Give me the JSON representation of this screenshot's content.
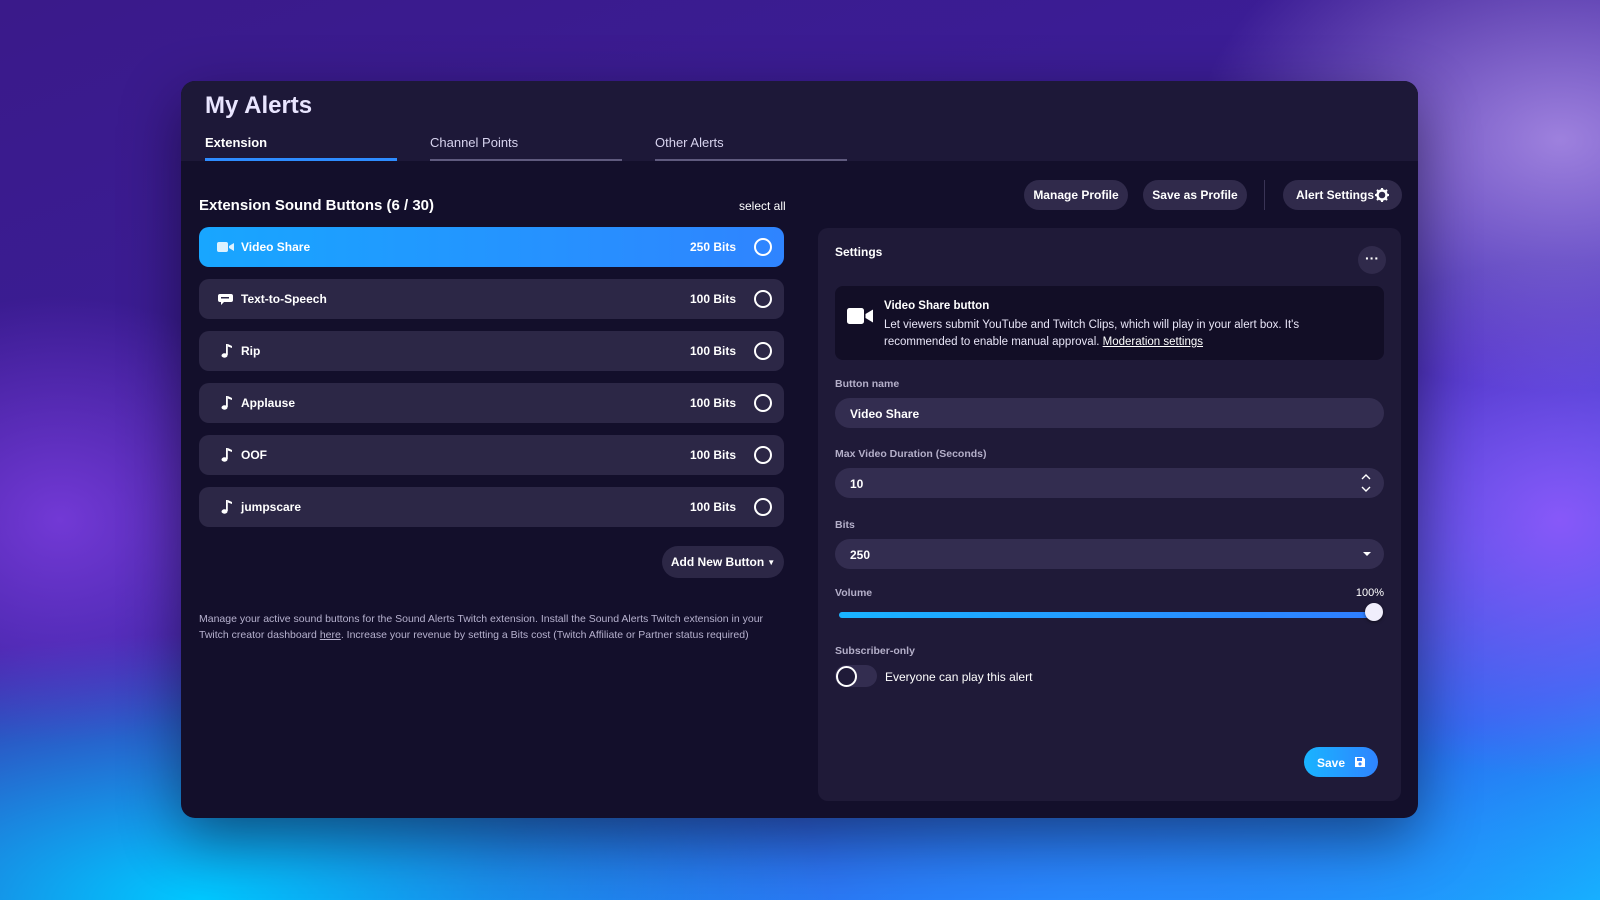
{
  "app": {
    "title": "My Alerts"
  },
  "tabs": [
    {
      "label": "Extension",
      "active": true
    },
    {
      "label": "Channel Points",
      "active": false
    },
    {
      "label": "Other Alerts",
      "active": false
    }
  ],
  "list": {
    "heading": "Extension Sound Buttons (6 / 30)",
    "select_all": "select all",
    "items": [
      {
        "label": "Video Share",
        "cost": "250 Bits",
        "icon": "video-camera-icon",
        "selected": true
      },
      {
        "label": "Text-to-Speech",
        "cost": "100 Bits",
        "icon": "speech-bubble-icon",
        "selected": false
      },
      {
        "label": "Rip",
        "cost": "100 Bits",
        "icon": "music-note-icon",
        "selected": false
      },
      {
        "label": "Applause",
        "cost": "100 Bits",
        "icon": "music-note-icon",
        "selected": false
      },
      {
        "label": "OOF",
        "cost": "100 Bits",
        "icon": "music-note-icon",
        "selected": false
      },
      {
        "label": "jumpscare",
        "cost": "100 Bits",
        "icon": "music-note-icon",
        "selected": false
      }
    ],
    "add_button": "Add New Button",
    "help": {
      "part1": "Manage your active sound buttons for the Sound Alerts Twitch extension. Install the Sound Alerts Twitch extension in your Twitch creator dashboard ",
      "link": "here",
      "part2": ". Increase your revenue by setting a Bits cost (Twitch Affiliate or Partner status required)"
    }
  },
  "toolbar": {
    "manage_profile": "Manage Profile",
    "save_as_profile": "Save as Profile",
    "alert_settings": "Alert Settings"
  },
  "settings": {
    "title": "Settings",
    "more": "···",
    "info": {
      "title": "Video Share button",
      "desc": "Let viewers submit YouTube and Twitch Clips, which will play in your alert box. It's recommended to enable manual approval. ",
      "link": "Moderation settings"
    },
    "button_name_label": "Button name",
    "button_name_value": "Video Share",
    "max_duration_label": "Max Video Duration (Seconds)",
    "max_duration_value": "10",
    "bits_label": "Bits",
    "bits_value": "250",
    "volume_label": "Volume",
    "volume_pct": "100%",
    "volume_fraction": 1.0,
    "subscriber_label": "Subscriber-only",
    "subscriber_only": false,
    "toggle_text": "Everyone can play this alert",
    "save": "Save"
  },
  "colors": {
    "accent": "#2f84ff",
    "accent_cyan": "#18a6ff",
    "panel": "#1f1a38",
    "window": "#130f2b"
  }
}
